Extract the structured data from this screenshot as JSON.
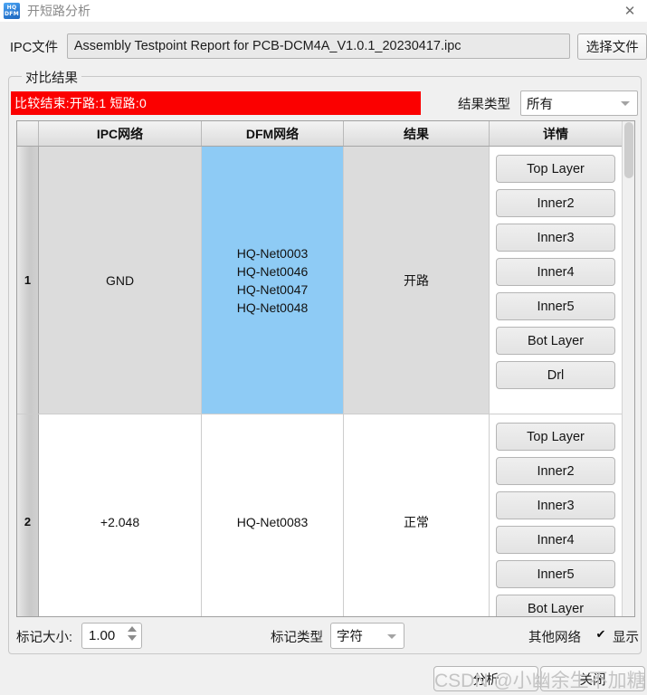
{
  "window": {
    "title": "开短路分析",
    "icon": "hq-dfm-logo",
    "icon_line1": "HQ",
    "icon_line2": "DFM",
    "close_glyph": "✕"
  },
  "ipc_row": {
    "label": "IPC文件",
    "file_value": "Assembly Testpoint Report for PCB-DCM4A_V1.0.1_20230417.ipc",
    "choose_button": "选择文件"
  },
  "groupbox": {
    "title": "对比结果"
  },
  "status": {
    "text": "比较结束:开路:1 短路:0",
    "background": "#fb0000",
    "color": "#ffffff"
  },
  "filter": {
    "label": "结果类型",
    "value": "所有"
  },
  "table": {
    "columns": [
      "",
      "IPC网络",
      "DFM网络",
      "结果",
      "详情"
    ],
    "rows": [
      {
        "index": "1",
        "ipc_net": "GND",
        "dfm_net": "HQ-Net0003\nHQ-Net0046\nHQ-Net0047\nHQ-Net0048",
        "dfm_net_lines": [
          "HQ-Net0003",
          "HQ-Net0046",
          "HQ-Net0047",
          "HQ-Net0048"
        ],
        "result": "开路",
        "selected_cell": "dfm_net",
        "selection_color": "#8ecbf5",
        "row_background": "#dcdcdc",
        "detail_buttons": [
          "Top Layer",
          "Inner2",
          "Inner3",
          "Inner4",
          "Inner5",
          "Bot Layer",
          "Drl"
        ]
      },
      {
        "index": "2",
        "ipc_net": "+2.048",
        "dfm_net": "HQ-Net0083",
        "dfm_net_lines": [
          "HQ-Net0083"
        ],
        "result": "正常",
        "selected_cell": "",
        "row_background": "#ffffff",
        "detail_buttons": [
          "Top Layer",
          "Inner2",
          "Inner3",
          "Inner4",
          "Inner5",
          "Bot Layer"
        ]
      }
    ]
  },
  "bottom": {
    "mark_size_label": "标记大小:",
    "mark_size_value": "1.00",
    "mark_type_label": "标记类型",
    "mark_type_value": "字符",
    "other_net_label": "其他网络",
    "checkbox_checked": true,
    "checkbox_glyph": "✔",
    "show_label": "显示"
  },
  "footer": {
    "analyze_button": "分析",
    "close_button": "关闭"
  },
  "watermark": {
    "text": "CSDN @小幽余生不加糖"
  }
}
